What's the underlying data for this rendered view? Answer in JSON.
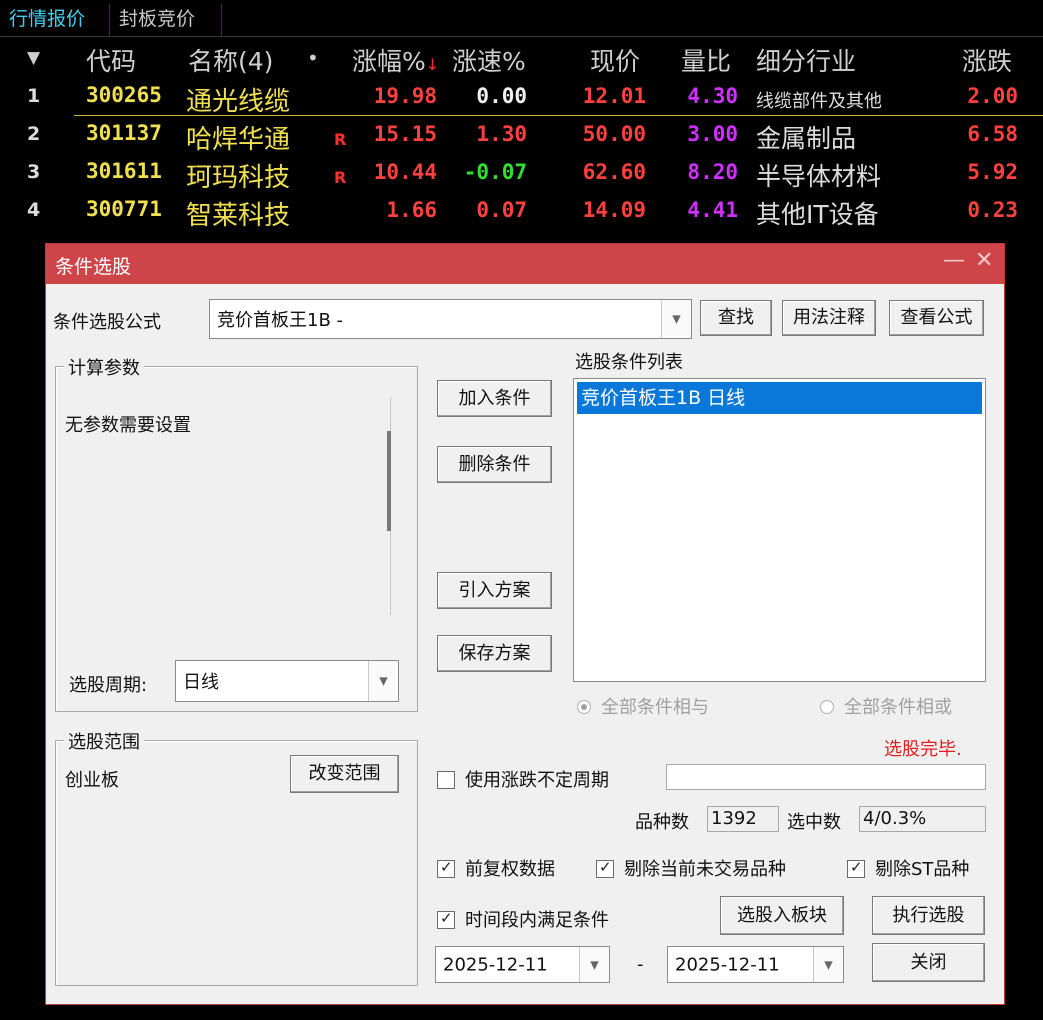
{
  "tabs": [
    {
      "label": "行情报价"
    },
    {
      "label": "封板竞价"
    }
  ],
  "table": {
    "headers": {
      "sort_icon": "▼",
      "code": "代码",
      "name": "名称(4)",
      "dot": "•",
      "zf": "涨幅%",
      "zf_sort": "↓",
      "zs": "涨速%",
      "xj": "现价",
      "lb": "量比",
      "hy": "细分行业",
      "zd": "涨跌"
    },
    "rows": [
      {
        "idx": "1",
        "code": "300265",
        "name": "通光线缆",
        "flag": "",
        "zf": "19.98",
        "zs": "0.00",
        "xj": "12.01",
        "lb": "4.30",
        "hy": "线缆部件及其他",
        "zd": "2.00"
      },
      {
        "idx": "2",
        "code": "301137",
        "name": "哈焊华通",
        "flag": "R",
        "zf": "15.15",
        "zs": "1.30",
        "xj": "50.00",
        "lb": "3.00",
        "hy": "金属制品",
        "zd": "6.58"
      },
      {
        "idx": "3",
        "code": "301611",
        "name": "珂玛科技",
        "flag": "R",
        "zf": "10.44",
        "zs": "-0.07",
        "xj": "62.60",
        "lb": "8.20",
        "hy": "半导体材料",
        "zd": "5.92"
      },
      {
        "idx": "4",
        "code": "300771",
        "name": "智莱科技",
        "flag": "",
        "zf": "1.66",
        "zs": "0.07",
        "xj": "14.09",
        "lb": "4.41",
        "hy": "其他IT设备",
        "zd": "0.23"
      }
    ]
  },
  "dialog": {
    "title": "条件选股",
    "minimize_glyph": "—",
    "close_glyph": "✕",
    "formula_label": "条件选股公式",
    "formula_value": "竞价首板王1B  -",
    "find_button": "查找",
    "usage_button": "用法注释",
    "view_button": "查看公式",
    "params_group": "计算参数",
    "params_text": "无参数需要设置",
    "period_label": "选股周期:",
    "period_value": "日线",
    "add_button": "加入条件",
    "delete_button": "删除条件",
    "import_button": "引入方案",
    "save_button": "保存方案",
    "conditions_label": "选股条件列表",
    "conditions": [
      "竞价首板王1B  日线"
    ],
    "radio_and": "全部条件相与",
    "radio_or": "全部条件相或",
    "status_text": "选股完毕.",
    "scope_group": "选股范围",
    "scope_value": "创业板",
    "change_scope_button": "改变范围",
    "variable_period_label": "使用涨跌不定周期",
    "variable_period_value": "",
    "count_label": "品种数",
    "count_value": "1392",
    "selected_label": "选中数",
    "selected_value": "4/0.3%",
    "fq_label": "前复权数据",
    "exclude_untraded_label": "剔除当前未交易品种",
    "exclude_st_label": "剔除ST品种",
    "time_range_label": "时间段内满足条件",
    "to_block_button": "选股入板块",
    "execute_button": "执行选股",
    "date_start": "2025-12-11",
    "date_sep": "-",
    "date_end": "2025-12-11",
    "close_button": "关闭"
  },
  "colors": {
    "title_bar": "#cd4548",
    "selection": "#0a78d8",
    "price_up": "#ff4040",
    "price_down": "#30e030",
    "stock_code": "#f0e050",
    "volume_ratio": "#d030ff"
  }
}
